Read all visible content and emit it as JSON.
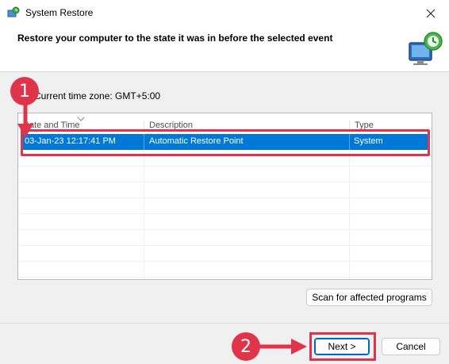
{
  "window": {
    "title": "System Restore",
    "icon": "system-restore-icon"
  },
  "header": {
    "title": "Restore your computer to the state it was in before the selected event",
    "icon": "monitor-restore-icon"
  },
  "timezone_label": "Current time zone: GMT+5:00",
  "table": {
    "columns": [
      "Date and Time",
      "Description",
      "Type"
    ],
    "rows": [
      {
        "date": "03-Jan-23 12:17:41 PM",
        "description": "Automatic Restore Point",
        "type": "System",
        "selected": true
      }
    ]
  },
  "buttons": {
    "scan": "Scan for affected programs",
    "next": "Next >",
    "cancel": "Cancel"
  },
  "annotations": {
    "step1": "1",
    "step2": "2",
    "color": "#e0344a"
  }
}
